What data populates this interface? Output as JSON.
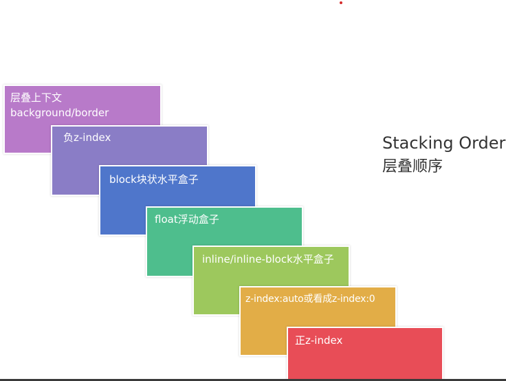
{
  "title": "Stacking Order",
  "subtitle": "层叠顺序",
  "layers": [
    {
      "lines": [
        "层叠上下文",
        "background/border"
      ],
      "color": "#b87ac9"
    },
    {
      "lines": [
        "负z-index"
      ],
      "color": "#8a7dc6"
    },
    {
      "lines": [
        "block块状水平盒子"
      ],
      "color": "#4f76cb"
    },
    {
      "lines": [
        "float浮动盒子"
      ],
      "color": "#4ebe8d"
    },
    {
      "lines": [
        "inline/inline-block水平盒子"
      ],
      "color": "#9dc85d"
    },
    {
      "lines": [
        "z-index:auto或看成z-index:0"
      ],
      "color": "#e2ad47"
    },
    {
      "lines": [
        "正z-index"
      ],
      "color": "#e84d57"
    }
  ]
}
